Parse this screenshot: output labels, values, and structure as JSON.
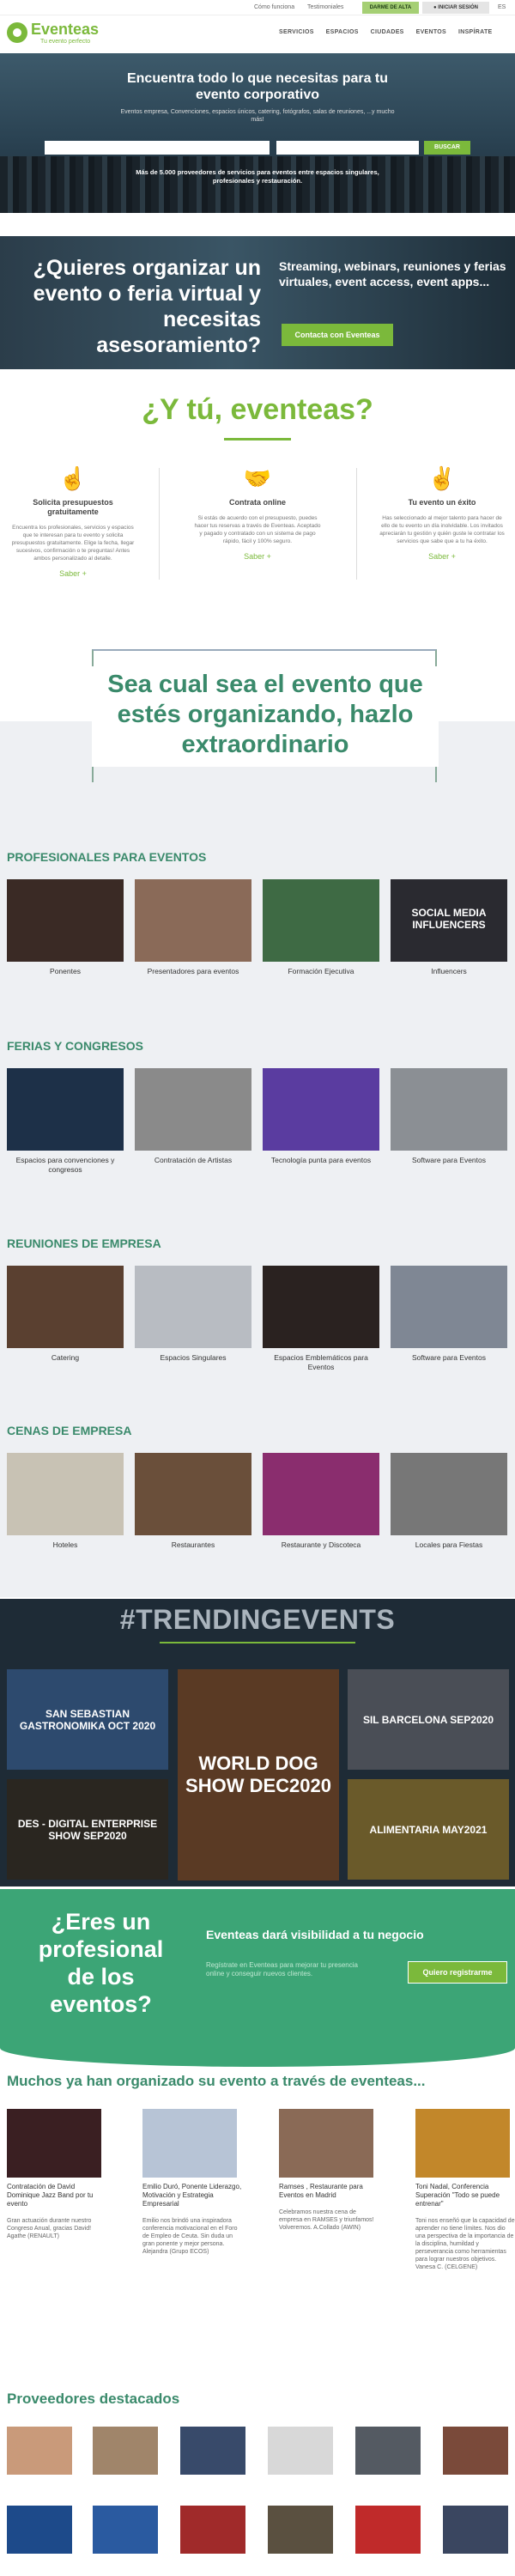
{
  "topbar": {
    "como_funciona": "Cómo funciona",
    "testimoniales": "Testimoniales",
    "alta": "DARME DE ALTA",
    "login": "INICIAR SESIÓN",
    "lang": "ES"
  },
  "header": {
    "logo": "Eventeas",
    "tagline": "Tu evento perfecto",
    "nav": [
      "SERVICIOS",
      "ESPACIOS",
      "CIUDADES",
      "EVENTOS",
      "INSPÍRATE"
    ]
  },
  "hero": {
    "title": "Encuentra todo lo que necesitas para tu evento corporativo",
    "subtitle": "Eventos empresa, Convenciones, espacios únicos, catering, fotógrafos, salas de reuniones, ...y mucho más!",
    "search_btn": "BUSCAR",
    "info": "Más de 5.000 proveedores de servicios para eventos entre espacios singulares, profesionales y restauración."
  },
  "virtual": {
    "question": "¿Quieres organizar un evento o feria virtual y necesitas asesoramiento?",
    "services": "Streaming, webinars, reuniones y ferias virtuales, event access, event apps...",
    "button": "Contacta con Eventeas"
  },
  "eventeas": {
    "title": "¿Y tú, eventeas?",
    "steps": [
      {
        "icon": "☝",
        "title": "Solicita presupuestos gratuitamente",
        "desc": "Encuentra los profesionales, servicios y espacios que te interesan para tu evento y solicita presupuestos gratuitamente. Elige la fecha, llegar sucesivos, confirmación o te preguntas! Antes ambos personalizado al detalle.",
        "link": "Saber +"
      },
      {
        "icon": "🤝",
        "title": "Contrata online",
        "desc": "Si estás de acuerdo con el presupuesto, puedes hacer tus reservas a través de Eventeas. Aceptado y pagado y contratado con un sistema de pago rápido, fácil y 100% seguro.",
        "link": "Saber +"
      },
      {
        "icon": "✌",
        "title": "Tu evento un éxito",
        "desc": "Has seleccionado al mejor talento para hacer de ello de tu evento un día inolvidable. Los invitados apreciarán tu gestión y quién guste le contratar los servicios que sabe que a tu ha éxito.",
        "link": "Saber +"
      }
    ]
  },
  "extra": "Sea cual sea el evento que estés organizando, hazlo extraordinario",
  "sections": [
    {
      "title": "PROFESIONALES PARA EVENTOS",
      "cards": [
        "Ponentes",
        "Presentadores para eventos",
        "Formación Ejecutiva",
        "Influencers"
      ],
      "colors": [
        "#3a2a25",
        "#6b4d3f",
        "#2f5a34",
        "#2a2a30"
      ]
    },
    {
      "title": "FERIAS Y CONGRESOS",
      "cards": [
        "Espacios para convenciones y congresos",
        "Contratación de Artistas",
        "Tecnología punta para eventos",
        "Software para Eventos"
      ],
      "colors": [
        "#1d3048",
        "#888888",
        "#5a3ca0",
        "#8b8f94"
      ]
    },
    {
      "title": "REUNIONES DE EMPRESA",
      "cards": [
        "Catering",
        "Espacios Singulares",
        "Espacios Emblemáticos para Eventos",
        "Software para Eventos"
      ],
      "colors": [
        "#5a4030",
        "#b8bcc2",
        "#2a2220",
        "#7f8794"
      ]
    },
    {
      "title": "CENAS DE EMPRESA",
      "cards": [
        "Hoteles",
        "Restaurantes",
        "Restaurante y Discoteca",
        "Locales para Fiestas"
      ],
      "colors": [
        "#c8c2b4",
        "#6a4f3a",
        "#8a2d6e",
        "#777777"
      ]
    }
  ],
  "social_media_card_text": "SOCIAL MEDIA INFLUENCERS",
  "trending": {
    "title": "#TRENDINGEVENTS",
    "tiles": [
      "SAN SEBASTIAN GASTRONOMIKA OCT 2020",
      "WORLD DOG SHOW DEC2020",
      "SIL BARCELONA SEP2020",
      "DES - DIGITAL ENTERPRISE SHOW SEP2020",
      "ALIMENTARIA MAY2021"
    ]
  },
  "visibility": {
    "big": "¿Eres un profesional de los eventos?",
    "mid": "Eventeas dará visibilidad a tu negocio",
    "small": "Regístrate en Eventeas para mejorar tu presencia online y conseguir nuevos clientes.",
    "button": "Quiero registrarme"
  },
  "testimonials": {
    "title": "Muchos ya han organizado su evento a través de eventeas...",
    "items": [
      {
        "title": "Contratación de David Dominique Jazz Band por tu evento",
        "desc": "Gran actuación durante nuestro Congreso Anual, gracias David! Agathe (RENAULT)"
      },
      {
        "title": "Emilio Duró, Ponente Liderazgo, Motivación y Estrategia Empresarial",
        "desc": "Emilio nos brindó una inspiradora conferencia motivacional en el Foro de Empleo de Ceuta. Sin duda un gran ponente y mejor persona. Alejandra (Grupo ECOS)"
      },
      {
        "title": "Ramses , Restaurante para Eventos en Madrid",
        "desc": "Celebramos nuestra cena de empresa en RAMSES y triunfamos! Volveremos. A.Collado (AWIN)"
      },
      {
        "title": "Toni Nadal, Conferencia Superación \"Todo se puede entrenar\"",
        "desc": "Toni nos enseñó que la capacidad de aprender no tiene límites. Nos dio una perspectiva de la importancia de la disciplina, humildad y perseverancia como herramientas para lograr nuestros objetivos. Vanesa C. (CELGENE)"
      }
    ]
  },
  "providers": {
    "title": "Proveedores destacados"
  }
}
